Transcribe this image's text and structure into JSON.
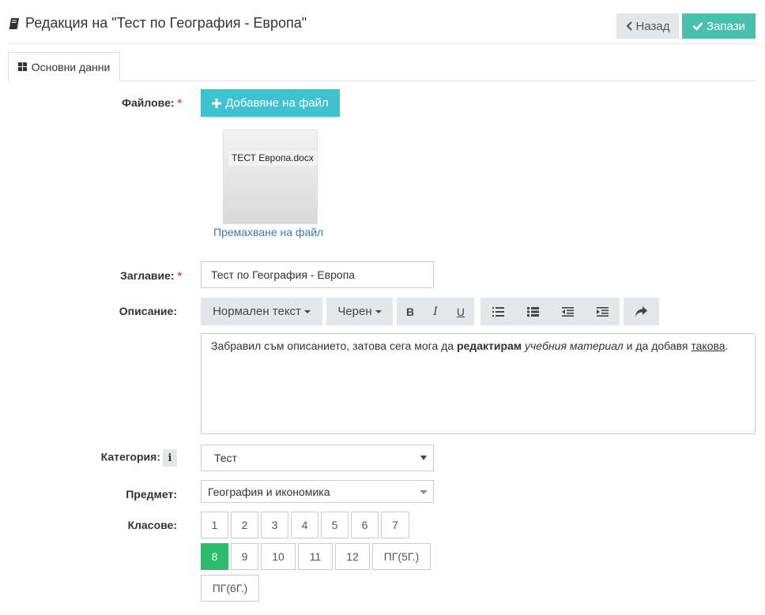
{
  "header": {
    "title": "Редакция на \"Тест по География - Европа\"",
    "back_label": "Назад",
    "save_label": "Запази"
  },
  "tabs": [
    {
      "label": "Основни данни"
    }
  ],
  "form": {
    "files_label": "Файлове:",
    "add_file_label": "Добавяне на файл",
    "file_name": "ТЕСТ Европа.docx",
    "remove_file_label": "Премахване на файл",
    "title_label": "Заглавие:",
    "title_value": "Тест по География - Европа",
    "description_label": "Описание:",
    "toolbar": {
      "format_label": "Нормален текст",
      "color_label": "Черен",
      "bold": "B",
      "italic": "I",
      "underline": "U"
    },
    "description": {
      "part1": "Забравил съм описанието, затова сега мога да ",
      "bold": "редактирам",
      "part2": " ",
      "italic": "учебния материал",
      "part3": " и да добавя ",
      "underline": "такова",
      "part4": "."
    },
    "category_label": "Категория:",
    "category_info": "i",
    "category_value": "Тест",
    "subject_label": "Предмет:",
    "subject_value": "География и икономика",
    "grades_label": "Класове:",
    "grades": [
      "1",
      "2",
      "3",
      "4",
      "5",
      "6",
      "7",
      "8",
      "9",
      "10",
      "11",
      "12",
      "ПГ(5Г.)",
      "ПГ(6Г.)"
    ],
    "selected_grade": "8",
    "required_mark": "*"
  },
  "colors": {
    "save": "#4abfad",
    "add_file": "#3fc1d1",
    "active_grade": "#2dbb6e",
    "link": "#3b7ab8",
    "required": "#d9534f"
  }
}
